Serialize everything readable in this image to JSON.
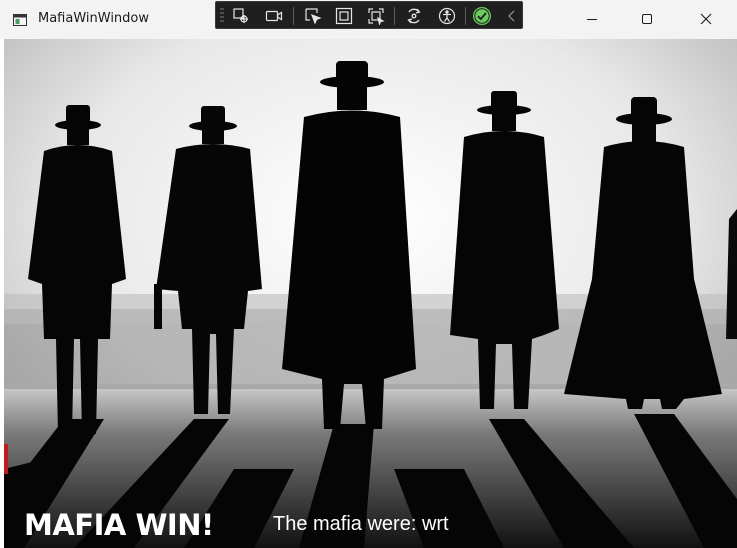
{
  "window": {
    "title": "MafiaWinWindow",
    "icons": {
      "app": "app-window-icon",
      "minimize": "minimize-icon",
      "maximize": "maximize-icon",
      "close": "close-icon"
    }
  },
  "debug_toolbar": {
    "icons": [
      "live-visual-tree-icon",
      "select-element-icon",
      "display-layout-adorners-icon",
      "track-focused-element-icon",
      "hot-reload-icon",
      "accessibility-checker-icon",
      "binding-check-icon",
      "collapse-chevron-icon"
    ]
  },
  "main": {
    "background_image": "mafia-silhouettes-image",
    "heading": "MAFIA WIN!",
    "mafia_reveal": "The mafia were: wrt"
  },
  "colors": {
    "heading_text": "#ffffff",
    "titlebar_bg": "#f3f3f3",
    "toolbar_bg": "#1f1f1f",
    "check_green": "#6ccb5f"
  }
}
